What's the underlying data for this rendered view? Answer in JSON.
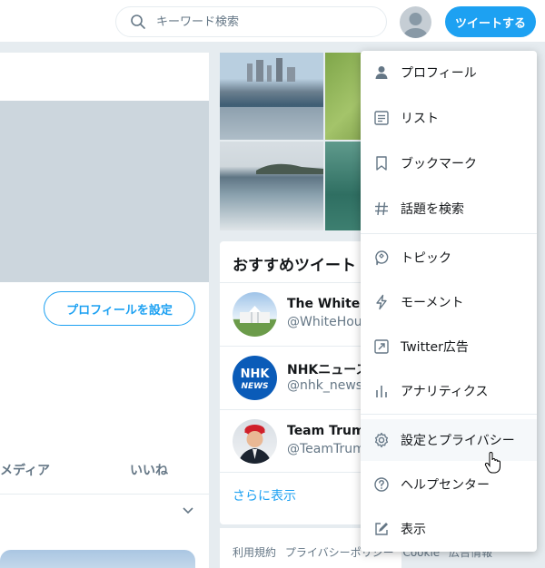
{
  "search": {
    "placeholder": "キーワード検索",
    "icon": "search-icon"
  },
  "header": {
    "tweet_button": "ツイートする"
  },
  "profile": {
    "setup_button": "プロフィールを設定",
    "tabs": [
      {
        "label": "メディア"
      },
      {
        "label": "いいね"
      }
    ]
  },
  "recommend": {
    "title": "おすすめツイート",
    "accounts": [
      {
        "name": "The White H",
        "handle": "@WhiteHou"
      },
      {
        "name": "NHKニュース",
        "handle": "@nhk_news"
      },
      {
        "name": "Team Trump",
        "handle": "@TeamTrum"
      }
    ],
    "more_link": "さらに表示",
    "nhk_logo": {
      "line1": "NHK",
      "line2": "NEWS"
    }
  },
  "footer": {
    "links": [
      "利用規約",
      "プライバシーポリシー",
      "Cookie",
      "広告情報"
    ]
  },
  "menu": {
    "items": [
      {
        "label": "プロフィール",
        "icon": "person-icon"
      },
      {
        "label": "リスト",
        "icon": "list-icon"
      },
      {
        "label": "ブックマーク",
        "icon": "bookmark-icon"
      },
      {
        "label": "話題を検索",
        "icon": "hashtag-icon"
      },
      {
        "label": "トピック",
        "icon": "topic-icon"
      },
      {
        "label": "モーメント",
        "icon": "lightning-icon"
      },
      {
        "label": "Twitter広告",
        "icon": "ads-arrow-icon"
      },
      {
        "label": "アナリティクス",
        "icon": "analytics-icon"
      },
      {
        "label": "設定とプライバシー",
        "icon": "gear-icon"
      },
      {
        "label": "ヘルプセンター",
        "icon": "help-icon"
      },
      {
        "label": "表示",
        "icon": "display-edit-icon"
      }
    ]
  },
  "colors": {
    "accent": "#1da1f2",
    "background": "#e6ecf0",
    "muted": "#657786"
  }
}
